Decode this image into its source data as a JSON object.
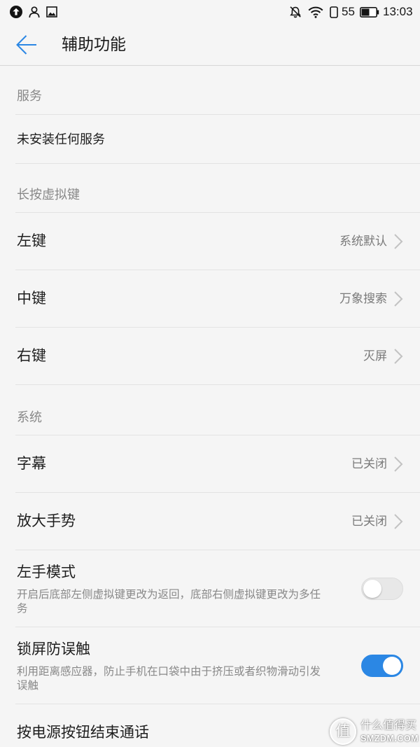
{
  "status_bar": {
    "left_icons": [
      "upload-icon",
      "person-icon",
      "image-icon"
    ],
    "right_icons": [
      "mute-icon",
      "wifi-icon",
      "sim-icon",
      "battery-icon"
    ],
    "battery_percent": "55",
    "time": "13:03"
  },
  "header": {
    "back_icon": "back-arrow-icon",
    "title": "辅助功能"
  },
  "services": {
    "header": "服务",
    "empty_text": "未安装任何服务"
  },
  "virtual_keys": {
    "header": "长按虚拟键",
    "items": [
      {
        "label": "左键",
        "value": "系统默认"
      },
      {
        "label": "中键",
        "value": "万象搜索"
      },
      {
        "label": "右键",
        "value": "灭屏"
      }
    ]
  },
  "system": {
    "header": "系统",
    "items": [
      {
        "label": "字幕",
        "value": "已关闭"
      },
      {
        "label": "放大手势",
        "value": "已关闭"
      }
    ],
    "toggles": [
      {
        "label": "左手模式",
        "description": "开启后底部左侧虚拟键更改为返回，底部右侧虚拟键更改为多任务",
        "enabled": false
      },
      {
        "label": "锁屏防误触",
        "description": "利用距离感应器，防止手机在口袋中由于挤压或者织物滑动引发误触",
        "enabled": true
      }
    ],
    "end_call": {
      "label": "按电源按钮结束通话"
    }
  },
  "watermark": {
    "logo": "值",
    "name": "什么值得买",
    "domain": "SMZDM.COM"
  },
  "colors": {
    "accent": "#2b87e4",
    "background": "#f5f5f5",
    "secondary_text": "#888888"
  }
}
